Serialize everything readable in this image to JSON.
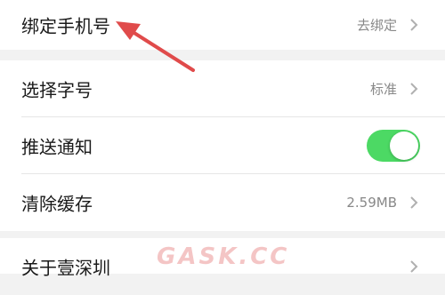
{
  "settings": {
    "bind_phone": {
      "label": "绑定手机号",
      "value": "去绑定",
      "chevron_icon": "chevron-right-icon"
    },
    "font_size": {
      "label": "选择字号",
      "value": "标准",
      "chevron_icon": "chevron-right-icon"
    },
    "push": {
      "label": "推送通知",
      "toggle_on": true,
      "toggle_color": "#4cd964"
    },
    "cache": {
      "label": "清除缓存",
      "value": "2.59MB",
      "chevron_icon": "chevron-right-icon"
    },
    "about": {
      "label": "关于壹深圳",
      "chevron_icon": "chevron-right-icon"
    }
  },
  "annotation": {
    "arrow_color": "#e04b4b",
    "arrow_icon": "arrow-pointer-icon"
  },
  "watermark": {
    "text": "GASK.CC"
  }
}
